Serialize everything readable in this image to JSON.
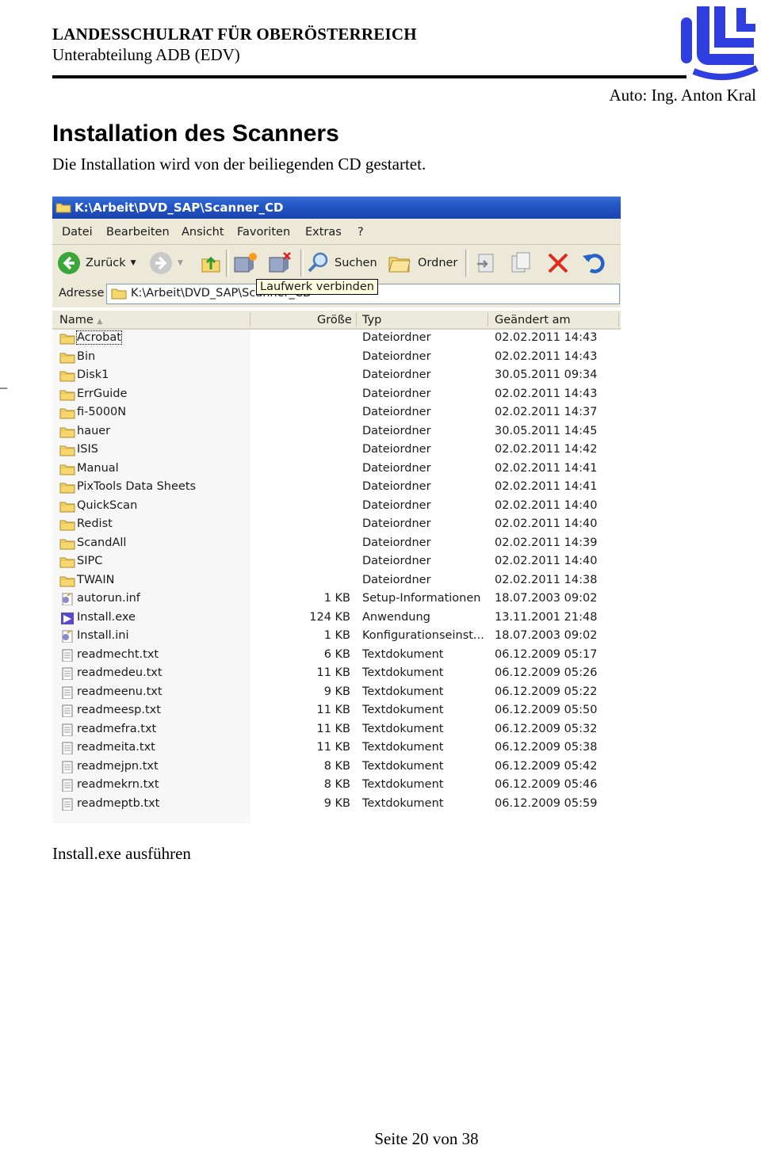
{
  "header": {
    "organization": "LANDESSCHULRAT FÜR OBERÖSTERREICH",
    "department": "Unterabteilung ADB (EDV)",
    "author": "Auto: Ing. Anton Kral"
  },
  "section": {
    "title": "Installation des Scanners",
    "intro": "Die Installation wird von der beiliegenden CD gestartet."
  },
  "margin_mark": "_",
  "explorer": {
    "title": "K:\\Arbeit\\DVD_SAP\\Scanner_CD",
    "menu": [
      "Datei",
      "Bearbeiten",
      "Ansicht",
      "Favoriten",
      "Extras",
      "?"
    ],
    "toolbar": {
      "back": "Zurück",
      "search": "Suchen",
      "folders": "Ordner"
    },
    "address_label": "Adresse",
    "address_value": "K:\\Arbeit\\DVD_SAP\\Scanner_CD",
    "tooltip": "Laufwerk verbinden",
    "columns": {
      "name": "Name",
      "size": "Größe",
      "type": "Typ",
      "modified": "Geändert am"
    },
    "files": [
      {
        "name": "Acrobat",
        "size": "",
        "type": "Dateiordner",
        "modified": "02.02.2011 14:43",
        "icon": "folder-icon"
      },
      {
        "name": "Bin",
        "size": "",
        "type": "Dateiordner",
        "modified": "02.02.2011 14:43",
        "icon": "folder-icon"
      },
      {
        "name": "Disk1",
        "size": "",
        "type": "Dateiordner",
        "modified": "30.05.2011 09:34",
        "icon": "folder-icon"
      },
      {
        "name": "ErrGuide",
        "size": "",
        "type": "Dateiordner",
        "modified": "02.02.2011 14:43",
        "icon": "folder-icon"
      },
      {
        "name": "fi-5000N",
        "size": "",
        "type": "Dateiordner",
        "modified": "02.02.2011 14:37",
        "icon": "folder-icon"
      },
      {
        "name": "hauer",
        "size": "",
        "type": "Dateiordner",
        "modified": "30.05.2011 14:45",
        "icon": "folder-icon"
      },
      {
        "name": "ISIS",
        "size": "",
        "type": "Dateiordner",
        "modified": "02.02.2011 14:42",
        "icon": "folder-icon"
      },
      {
        "name": "Manual",
        "size": "",
        "type": "Dateiordner",
        "modified": "02.02.2011 14:41",
        "icon": "folder-icon"
      },
      {
        "name": "PixTools Data Sheets",
        "size": "",
        "type": "Dateiordner",
        "modified": "02.02.2011 14:41",
        "icon": "folder-icon"
      },
      {
        "name": "QuickScan",
        "size": "",
        "type": "Dateiordner",
        "modified": "02.02.2011 14:40",
        "icon": "folder-icon"
      },
      {
        "name": "Redist",
        "size": "",
        "type": "Dateiordner",
        "modified": "02.02.2011 14:40",
        "icon": "folder-icon"
      },
      {
        "name": "ScandAll",
        "size": "",
        "type": "Dateiordner",
        "modified": "02.02.2011 14:39",
        "icon": "folder-icon"
      },
      {
        "name": "SIPC",
        "size": "",
        "type": "Dateiordner",
        "modified": "02.02.2011 14:40",
        "icon": "folder-icon"
      },
      {
        "name": "TWAIN",
        "size": "",
        "type": "Dateiordner",
        "modified": "02.02.2011 14:38",
        "icon": "folder-icon"
      },
      {
        "name": "autorun.inf",
        "size": "1 KB",
        "type": "Setup-Informationen",
        "modified": "18.07.2003 09:02",
        "icon": "settings-file-icon"
      },
      {
        "name": "Install.exe",
        "size": "124 KB",
        "type": "Anwendung",
        "modified": "13.11.2001 21:48",
        "icon": "application-icon"
      },
      {
        "name": "Install.ini",
        "size": "1 KB",
        "type": "Konfigurationseinst...",
        "modified": "18.07.2003 09:02",
        "icon": "settings-file-icon"
      },
      {
        "name": "readmecht.txt",
        "size": "6 KB",
        "type": "Textdokument",
        "modified": "06.12.2009 05:17",
        "icon": "text-file-icon"
      },
      {
        "name": "readmedeu.txt",
        "size": "11 KB",
        "type": "Textdokument",
        "modified": "06.12.2009 05:26",
        "icon": "text-file-icon"
      },
      {
        "name": "readmeenu.txt",
        "size": "9 KB",
        "type": "Textdokument",
        "modified": "06.12.2009 05:22",
        "icon": "text-file-icon"
      },
      {
        "name": "readmeesp.txt",
        "size": "11 KB",
        "type": "Textdokument",
        "modified": "06.12.2009 05:50",
        "icon": "text-file-icon"
      },
      {
        "name": "readmefra.txt",
        "size": "11 KB",
        "type": "Textdokument",
        "modified": "06.12.2009 05:32",
        "icon": "text-file-icon"
      },
      {
        "name": "readmeita.txt",
        "size": "11 KB",
        "type": "Textdokument",
        "modified": "06.12.2009 05:38",
        "icon": "text-file-icon"
      },
      {
        "name": "readmejpn.txt",
        "size": "8 KB",
        "type": "Textdokument",
        "modified": "06.12.2009 05:42",
        "icon": "text-file-icon"
      },
      {
        "name": "readmekrn.txt",
        "size": "8 KB",
        "type": "Textdokument",
        "modified": "06.12.2009 05:46",
        "icon": "text-file-icon"
      },
      {
        "name": "readmeptb.txt",
        "size": "9 KB",
        "type": "Textdokument",
        "modified": "06.12.2009 05:59",
        "icon": "text-file-icon"
      }
    ]
  },
  "caption": "Install.exe ausführen",
  "footer": "Seite 20 von 38"
}
